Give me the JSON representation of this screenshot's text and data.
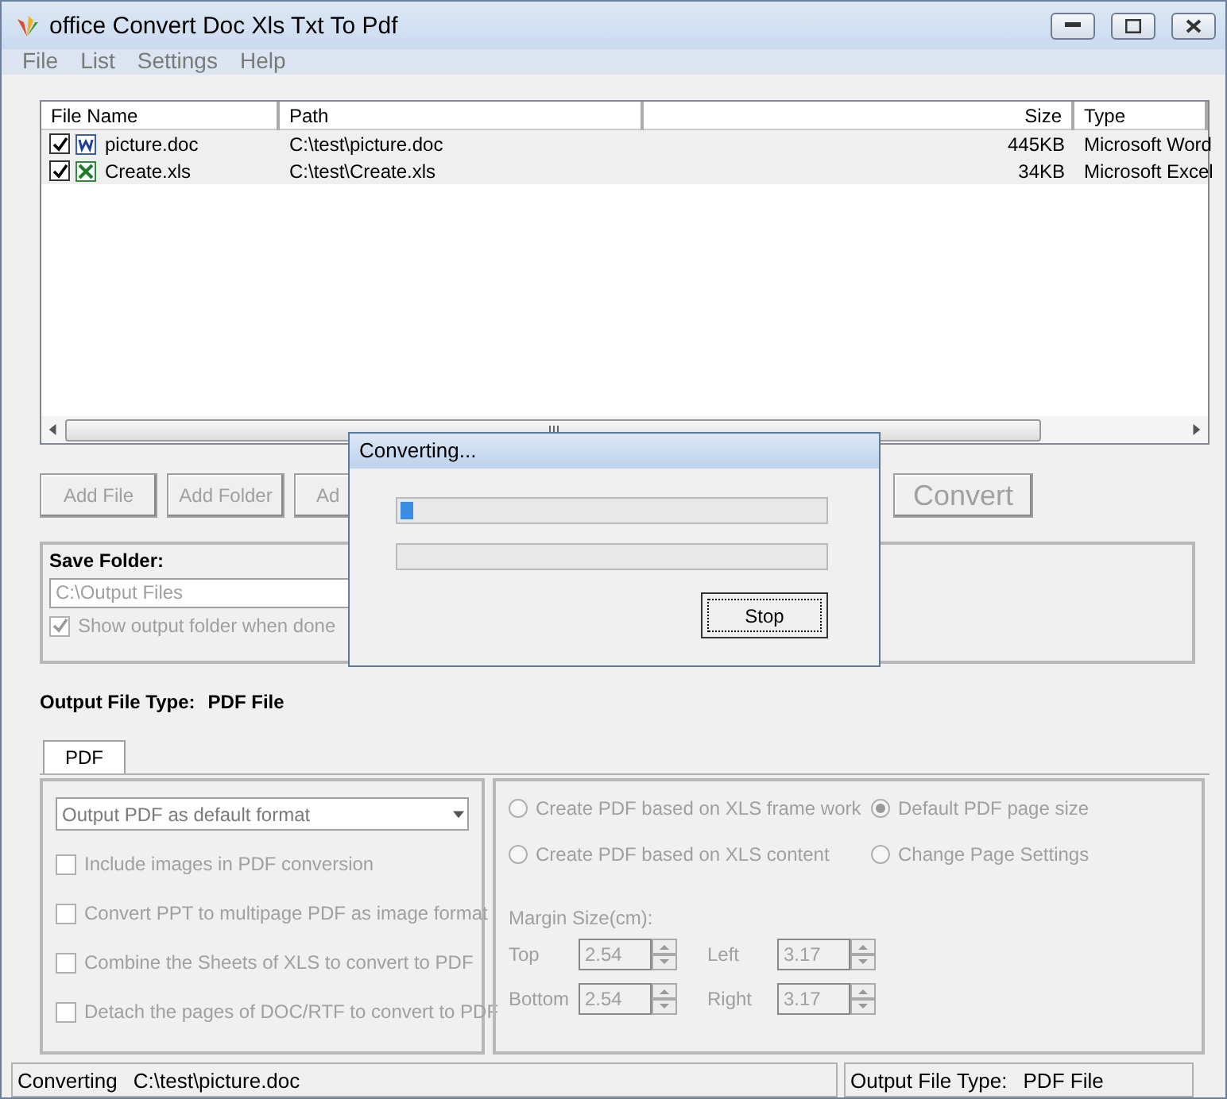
{
  "window": {
    "title": "office Convert Doc Xls Txt To Pdf"
  },
  "menu": [
    "File",
    "List",
    "Settings",
    "Help"
  ],
  "file_list": {
    "columns": [
      "File Name",
      "Path",
      "Size",
      "Type"
    ],
    "rows": [
      {
        "checked": true,
        "kind": "word",
        "name": "picture.doc",
        "path": "C:\\test\\picture.doc",
        "size": "445KB",
        "type": "Microsoft Word"
      },
      {
        "checked": true,
        "kind": "excel",
        "name": "Create.xls",
        "path": "C:\\test\\Create.xls",
        "size": "34KB",
        "type": "Microsoft Excel"
      }
    ]
  },
  "buttons": [
    {
      "label": "Add File",
      "disabled": true
    },
    {
      "label": "Add Folder",
      "disabled": true
    },
    {
      "label": "Ad",
      "disabled": true
    }
  ],
  "convert_button": {
    "label": "Convert",
    "disabled": true
  },
  "save_folder": {
    "label": "Save Folder:",
    "value": "C:\\Output Files",
    "show_folder": {
      "label": "Show output folder when done",
      "checked": true,
      "disabled": true
    }
  },
  "output_type": {
    "label": "Output File Type:",
    "value": "PDF File"
  },
  "tabs": [
    {
      "label": "PDF",
      "selected": true
    }
  ],
  "pdf_options": {
    "format": "Output PDF as default format",
    "checkboxes": [
      {
        "label": "Include images in PDF conversion",
        "checked": false,
        "disabled": true
      },
      {
        "label": "Convert PPT to multipage PDF as image format",
        "checked": false,
        "disabled": true
      },
      {
        "label": "Combine the Sheets of XLS to convert to PDF",
        "checked": false,
        "disabled": true
      },
      {
        "label": "Detach the pages of DOC/RTF to convert to PDF",
        "checked": false,
        "disabled": true
      }
    ]
  },
  "xls_options": [
    {
      "label": "Create PDF based on XLS frame work",
      "selected": false
    },
    {
      "label": "Create PDF based on XLS content",
      "selected": false
    }
  ],
  "page_options": [
    {
      "label": "Default PDF page size",
      "selected": true
    },
    {
      "label": "Change Page Settings",
      "selected": false
    }
  ],
  "margins": {
    "label": "Margin Size(cm):",
    "fields": [
      {
        "label": "Top",
        "value": "2.54"
      },
      {
        "label": "Left",
        "value": "3.17"
      },
      {
        "label": "Bottom",
        "value": "2.54"
      },
      {
        "label": "Right",
        "value": "3.17"
      }
    ]
  },
  "status_bar": {
    "left": [
      "Converting",
      "C:\\test\\picture.doc"
    ],
    "right": [
      "Output File Type:",
      "PDF File"
    ]
  },
  "dialog": {
    "title": "Converting...",
    "bars": [
      {
        "level": 0.03
      },
      {
        "level": 0
      }
    ],
    "button": "Stop"
  }
}
